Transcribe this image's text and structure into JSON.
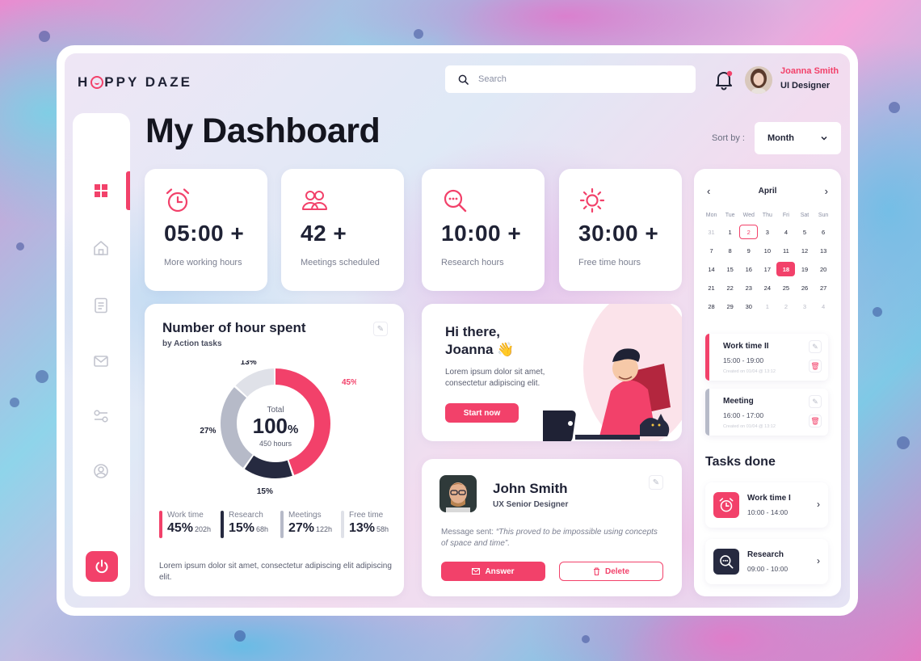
{
  "brand": {
    "name_prefix": "H",
    "name_suffix": "PPY DAZE"
  },
  "search": {
    "placeholder": "Search"
  },
  "user": {
    "name": "Joanna Smith",
    "role": "UI Designer"
  },
  "page": {
    "title": "My Dashboard",
    "sort_label": "Sort by :",
    "sort_value": "Month"
  },
  "stats": [
    {
      "icon": "alarm-clock-icon",
      "value": "05:00 +",
      "label": "More working hours"
    },
    {
      "icon": "users-icon",
      "value": "42 +",
      "label": "Meetings scheduled"
    },
    {
      "icon": "search-chat-icon",
      "value": "10:00 +",
      "label": "Research hours"
    },
    {
      "icon": "sun-icon",
      "value": "30:00 +",
      "label": "Free time hours"
    }
  ],
  "hours": {
    "title": "Number of hour spent",
    "subtitle": "by Action tasks",
    "center_label": "Total",
    "center_value": "100",
    "center_unit": "%",
    "center_sub": "450 hours",
    "slices": [
      {
        "name": "Work time",
        "percent": 45,
        "label": "45%",
        "hours": "202h",
        "color": "#f2416a"
      },
      {
        "name": "Research",
        "percent": 15,
        "label": "15%",
        "hours": "68h",
        "color": "#262a40"
      },
      {
        "name": "Meetings",
        "percent": 27,
        "label": "27%",
        "hours": "122h",
        "color": "#b6bac8"
      },
      {
        "name": "Free time",
        "percent": 13,
        "label": "13%",
        "hours": "58h",
        "color": "#dfe1e8"
      }
    ],
    "footer": "Lorem ipsum dolor sit amet, consectetur adipiscing elit adipiscing elit."
  },
  "greeting": {
    "line1": "Hi there,",
    "line2": "Joanna 👋",
    "text": "Lorem ipsum dolor sit amet, consectetur adipiscing elit.",
    "button": "Start now"
  },
  "message": {
    "name": "John Smith",
    "role": "UX Senior Designer",
    "prefix": "Message sent: ",
    "quote": "“This proved to be impossible using concepts of space and time”.",
    "answer": "Answer",
    "delete": "Delete"
  },
  "calendar": {
    "month": "April",
    "days": [
      "Mon",
      "Tue",
      "Wed",
      "Thu",
      "Fri",
      "Sat",
      "Sun"
    ],
    "cells": [
      {
        "d": "31",
        "s": "muted"
      },
      {
        "d": "1",
        "s": ""
      },
      {
        "d": "2",
        "s": "outl"
      },
      {
        "d": "3",
        "s": ""
      },
      {
        "d": "4",
        "s": ""
      },
      {
        "d": "5",
        "s": ""
      },
      {
        "d": "6",
        "s": ""
      },
      {
        "d": "7",
        "s": ""
      },
      {
        "d": "8",
        "s": ""
      },
      {
        "d": "9",
        "s": ""
      },
      {
        "d": "10",
        "s": ""
      },
      {
        "d": "11",
        "s": ""
      },
      {
        "d": "12",
        "s": ""
      },
      {
        "d": "13",
        "s": ""
      },
      {
        "d": "14",
        "s": ""
      },
      {
        "d": "15",
        "s": ""
      },
      {
        "d": "16",
        "s": ""
      },
      {
        "d": "17",
        "s": ""
      },
      {
        "d": "18",
        "s": "sel"
      },
      {
        "d": "19",
        "s": ""
      },
      {
        "d": "20",
        "s": ""
      },
      {
        "d": "21",
        "s": ""
      },
      {
        "d": "22",
        "s": ""
      },
      {
        "d": "23",
        "s": ""
      },
      {
        "d": "24",
        "s": ""
      },
      {
        "d": "25",
        "s": ""
      },
      {
        "d": "26",
        "s": ""
      },
      {
        "d": "27",
        "s": ""
      },
      {
        "d": "28",
        "s": ""
      },
      {
        "d": "29",
        "s": ""
      },
      {
        "d": "30",
        "s": ""
      },
      {
        "d": "1",
        "s": "muted"
      },
      {
        "d": "2",
        "s": "muted"
      },
      {
        "d": "3",
        "s": "muted"
      },
      {
        "d": "4",
        "s": "muted"
      }
    ]
  },
  "events": [
    {
      "title": "Work time II",
      "hours": "15:00 - 19:00",
      "created": "Created on 01/04 @ 13:12",
      "color": "#f2416a"
    },
    {
      "title": "Meeting",
      "hours": "16:00 - 17:00",
      "created": "Created on 01/04 @ 13:12",
      "color": "#b6bac8"
    }
  ],
  "tasks_done": {
    "title": "Tasks done",
    "items": [
      {
        "title": "Work time I",
        "hours": "10:00 - 14:00",
        "icon": "alarm-clock-icon",
        "color": "#f2416a"
      },
      {
        "title": "Research",
        "hours": "09:00 - 10:00",
        "icon": "search-chat-icon",
        "color": "#262a40"
      }
    ]
  }
}
